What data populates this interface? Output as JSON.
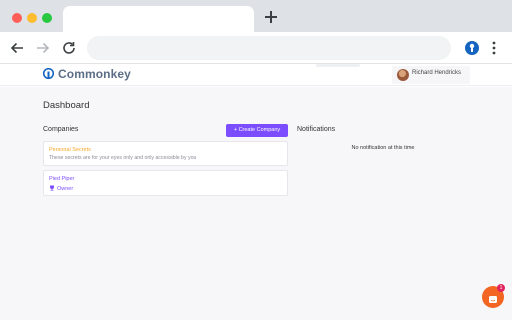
{
  "browser": {
    "icons": [
      "back-arrow-icon",
      "forward-arrow-icon",
      "reload-icon",
      "new-tab-plus-icon",
      "extension-icon",
      "kebab-menu-icon"
    ]
  },
  "app": {
    "brand": "Commonkey",
    "user": {
      "name": "Richard Hendricks"
    }
  },
  "dashboard": {
    "title": "Dashboard",
    "companies": {
      "label": "Companies",
      "create_button": "+ Create Company",
      "items": [
        {
          "title": "Personal Secrets",
          "subtitle": "These secrets are for your eyes only and only accessible by you"
        },
        {
          "title": "Pied Piper",
          "role": "Owner"
        }
      ]
    },
    "notifications": {
      "label": "Notifications",
      "empty_text": "No notification at this time"
    }
  },
  "chat": {
    "badge": "1"
  },
  "colors": {
    "accent": "#7c4dff",
    "personal_secrets": "#f5a623",
    "chat": "#f26522"
  }
}
